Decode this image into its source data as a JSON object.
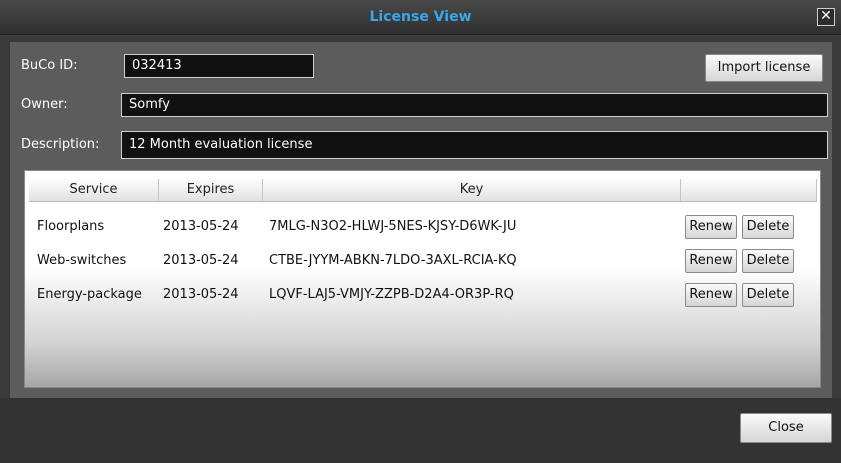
{
  "window": {
    "title": "License View",
    "close_glyph": "✕"
  },
  "form": {
    "buco_label": "BuCo ID:",
    "buco_value": "032413",
    "owner_label": "Owner:",
    "owner_value": "Somfy",
    "description_label": "Description:",
    "description_value": "12 Month evaluation license",
    "import_label": "Import license"
  },
  "table": {
    "headers": [
      "Service",
      "Expires",
      "Key",
      ""
    ],
    "rows": [
      {
        "service": "Floorplans",
        "expires": "2013-05-24",
        "key": "7MLG-N3O2-HLWJ-5NES-KJSY-D6WK-JU",
        "renew": "Renew",
        "delete": "Delete"
      },
      {
        "service": "Web-switches",
        "expires": "2013-05-24",
        "key": "CTBE-JYYM-ABKN-7LDO-3AXL-RCIA-KQ",
        "renew": "Renew",
        "delete": "Delete"
      },
      {
        "service": "Energy-package",
        "expires": "2013-05-24",
        "key": "LQVF-LAJ5-VMJY-ZZPB-D2A4-OR3P-RQ",
        "renew": "Renew",
        "delete": "Delete"
      }
    ]
  },
  "footer": {
    "close_label": "Close"
  },
  "colors": {
    "title": "#39a7ec",
    "panel": "#5c5c5c",
    "frame": "#3a3a3a"
  }
}
